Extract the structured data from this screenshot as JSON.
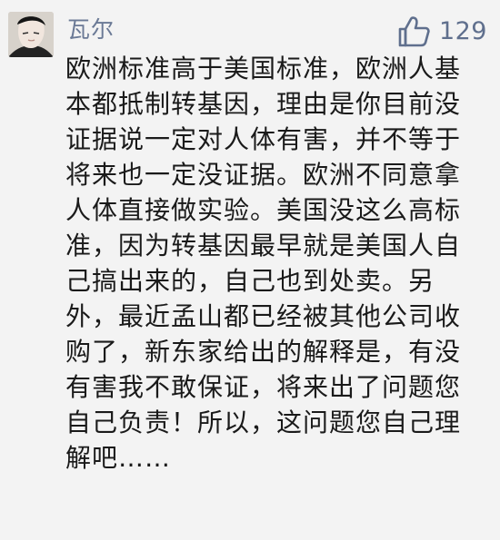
{
  "comment": {
    "username": "瓦尔",
    "likes": "129",
    "text": "欧洲标准高于美国标准，欧洲人基本都抵制转基因，理由是你目前没证据说一定对人体有害，并不等于将来也一定没证据。欧洲不同意拿人体直接做实验。美国没这么高标准，因为转基因最早就是美国人自己搞出来的，自己也到处卖。另外，最近孟山都已经被其他公司收购了，新东家给出的解释是，有没有害我不敢保证，将来出了问题您自己负责！所以，这问题您自己理解吧……"
  },
  "icons": {
    "like": "thumbs-up-icon",
    "avatar": "user-avatar"
  },
  "colors": {
    "background": "#f3f3f3",
    "username": "#6b7a96",
    "like": "#5f6f8d",
    "text": "#1a1a1a"
  }
}
